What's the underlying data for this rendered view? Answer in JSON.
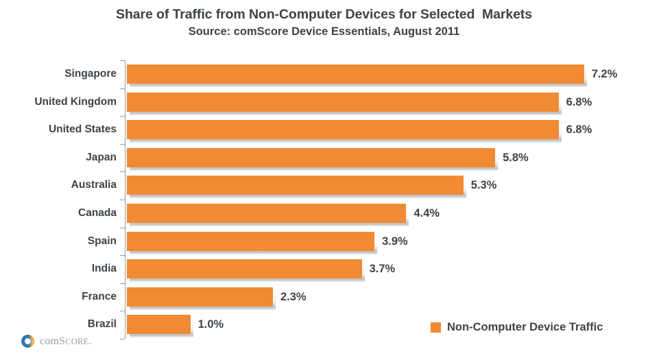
{
  "chart_data": {
    "type": "bar",
    "orientation": "horizontal",
    "title": "Share of Traffic from Non-Computer Devices for Selected  Markets",
    "subtitle": "Source: comScore Device Essentials, August 2011",
    "xlabel": "",
    "ylabel": "",
    "categories": [
      "Singapore",
      "United Kingdom",
      "United States",
      "Japan",
      "Australia",
      "Canada",
      "Spain",
      "India",
      "France",
      "Brazil"
    ],
    "values": [
      7.2,
      6.8,
      6.8,
      5.8,
      5.3,
      4.4,
      3.9,
      3.7,
      2.3,
      1.0
    ],
    "value_labels": [
      "7.2%",
      "6.8%",
      "6.8%",
      "5.8%",
      "5.3%",
      "4.4%",
      "3.9%",
      "3.7%",
      "2.3%",
      "1.0%"
    ],
    "xlim": [
      0,
      7.6
    ],
    "grid": false,
    "legend": {
      "position": "bottom-right",
      "entries": [
        {
          "label": "Non-Computer Device Traffic",
          "color": "#F08A33"
        }
      ]
    },
    "series": [
      {
        "name": "Non-Computer Device Traffic",
        "color": "#F08A33",
        "values": [
          7.2,
          6.8,
          6.8,
          5.8,
          5.3,
          4.4,
          3.9,
          3.7,
          2.3,
          1.0
        ]
      }
    ]
  },
  "colors": {
    "bar": "#F08A33",
    "text": "#3D4249",
    "axis": "#9A9A9A",
    "logo_text": "#9B9B9B",
    "logo_blue": "#2E74B5",
    "logo_orange": "#F08A33",
    "logo_yellow": "#F2C230",
    "background": "#FFFFFF"
  },
  "logo": {
    "name_part1": "com",
    "name_part2": "S",
    "name_part3": "CORE",
    "trademark": "."
  }
}
